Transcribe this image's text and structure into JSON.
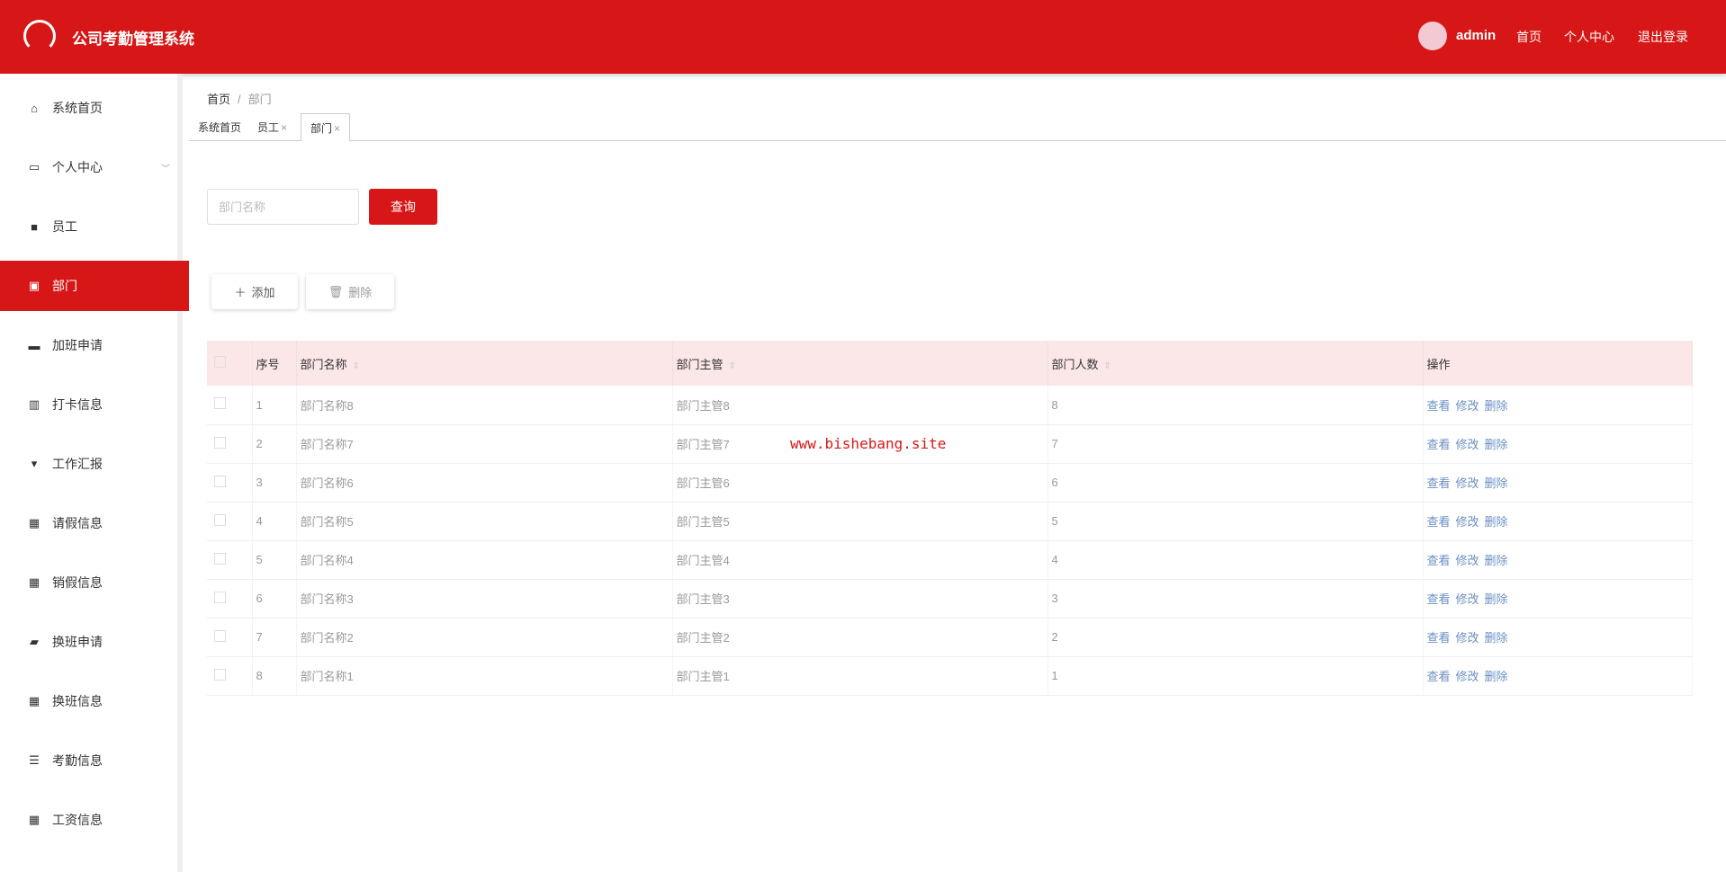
{
  "header": {
    "title": "公司考勤管理系统",
    "username": "admin",
    "nav": [
      "首页",
      "个人中心",
      "退出登录"
    ]
  },
  "sidebar": {
    "items": [
      {
        "label": "系统首页",
        "icon": "home-icon"
      },
      {
        "label": "个人中心",
        "icon": "card-icon"
      },
      {
        "label": "员工",
        "icon": "briefcase-icon"
      },
      {
        "label": "部门",
        "icon": "department-icon"
      },
      {
        "label": "加班申请",
        "icon": "monitor-icon"
      },
      {
        "label": "打卡信息",
        "icon": "chart-icon"
      },
      {
        "label": "工作汇报",
        "icon": "pin-icon"
      },
      {
        "label": "请假信息",
        "icon": "grid-icon"
      },
      {
        "label": "销假信息",
        "icon": "grid-icon"
      },
      {
        "label": "换班申请",
        "icon": "ticket-icon"
      },
      {
        "label": "换班信息",
        "icon": "grid-icon"
      },
      {
        "label": "考勤信息",
        "icon": "list-icon"
      },
      {
        "label": "工资信息",
        "icon": "grid-icon"
      }
    ]
  },
  "breadcrumb": {
    "home": "首页",
    "sep": "/",
    "current": "部门"
  },
  "tabs": [
    "系统首页",
    "员工",
    "部门"
  ],
  "search": {
    "placeholder": "部门名称",
    "button": "查询"
  },
  "actions": {
    "add": "添加",
    "delete": "删除"
  },
  "watermark": "www.bishebang.site",
  "table": {
    "headers": [
      "序号",
      "部门名称",
      "部门主管",
      "部门人数",
      "操作"
    ],
    "ops": [
      "查看",
      "修改",
      "删除"
    ],
    "rows": [
      [
        "1",
        "部门名称8",
        "部门主管8",
        "8"
      ],
      [
        "2",
        "部门名称7",
        "部门主管7",
        "7"
      ],
      [
        "3",
        "部门名称6",
        "部门主管6",
        "6"
      ],
      [
        "4",
        "部门名称5",
        "部门主管5",
        "5"
      ],
      [
        "5",
        "部门名称4",
        "部门主管4",
        "4"
      ],
      [
        "6",
        "部门名称3",
        "部门主管3",
        "3"
      ],
      [
        "7",
        "部门名称2",
        "部门主管2",
        "2"
      ],
      [
        "8",
        "部门名称1",
        "部门主管1",
        "1"
      ]
    ]
  }
}
